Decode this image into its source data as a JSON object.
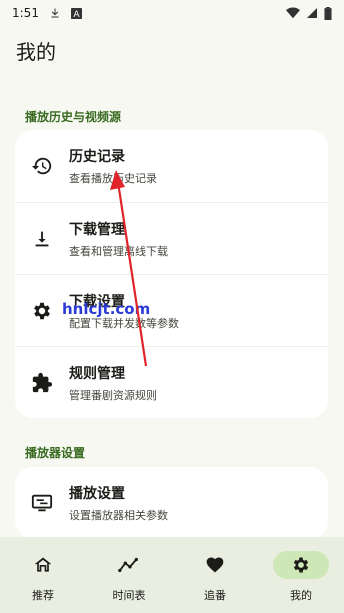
{
  "status_bar": {
    "time": "1:51",
    "icons": [
      "download-icon",
      "a-notification-icon",
      "wifi-icon",
      "signal-icon",
      "battery-icon"
    ]
  },
  "page_title": "我的",
  "sections": [
    {
      "header": "播放历史与视频源",
      "items": [
        {
          "title": "历史记录",
          "subtitle": "查看播放历史记录",
          "icon": "history-icon"
        },
        {
          "title": "下载管理",
          "subtitle": "查看和管理离线下载",
          "icon": "download-icon"
        },
        {
          "title": "下载设置",
          "subtitle": "配置下载并发数等参数",
          "icon": "gear-icon"
        },
        {
          "title": "规则管理",
          "subtitle": "管理番剧资源规则",
          "icon": "puzzle-icon"
        }
      ]
    },
    {
      "header": "播放器设置",
      "items": [
        {
          "title": "播放设置",
          "subtitle": "设置播放器相关参数",
          "icon": "player-settings-icon"
        }
      ]
    }
  ],
  "bottom_nav": [
    {
      "label": "推荐",
      "icon": "home-icon",
      "active": false
    },
    {
      "label": "时间表",
      "icon": "timeline-icon",
      "active": false
    },
    {
      "label": "追番",
      "icon": "heart-icon",
      "active": false
    },
    {
      "label": "我的",
      "icon": "gear-icon",
      "active": true
    }
  ],
  "watermark": "hnlcjt.com",
  "colors": {
    "background": "#f6f8f1",
    "accent": "#386a20",
    "active_nav": "#cde8b6",
    "annotation_arrow": "#e0242a"
  }
}
